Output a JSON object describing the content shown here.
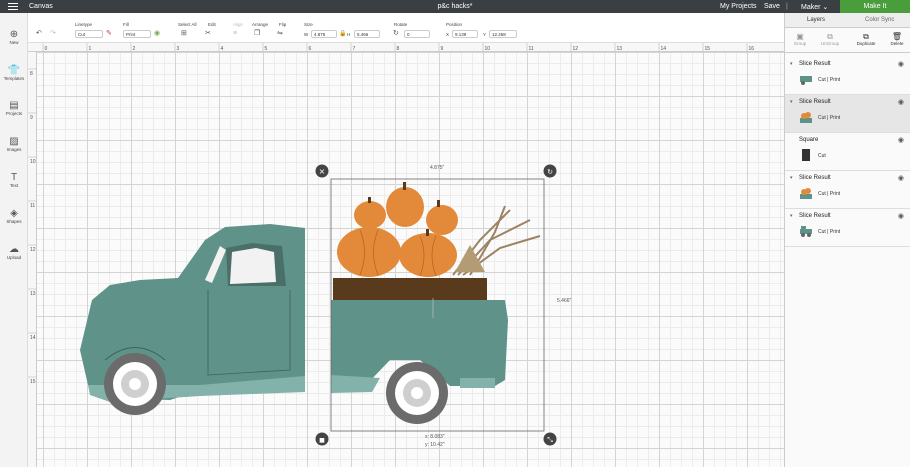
{
  "topbar": {
    "app_title": "Canvas",
    "doc_title": "p&c hacks*",
    "my_projects": "My Projects",
    "save": "Save",
    "separator": "|",
    "machine": "Maker",
    "machine_caret": "⌄",
    "make_it": "Make It"
  },
  "toolbar": {
    "linetype_label": "Linetype",
    "linetype_value": "Cut",
    "fill_label": "Fill",
    "fill_value": "Print",
    "select_all_label": "Select All",
    "edit_label": "Edit",
    "align_label": "Align",
    "arrange_label": "Arrange",
    "flip_label": "Flip",
    "size_label": "Size",
    "w_label": "W",
    "w_value": "4.875",
    "h_label": "H",
    "h_value": "5.466",
    "rotate_label": "Rotate",
    "rotate_value": "0",
    "position_label": "Position",
    "x_label": "X",
    "x_value": "9.139",
    "y_label": "Y",
    "y_value": "12.458"
  },
  "leftbar": {
    "items": [
      {
        "label": "New",
        "icon": "plus-icon"
      },
      {
        "label": "Templates",
        "icon": "shirt-icon"
      },
      {
        "label": "Projects",
        "icon": "projects-icon"
      },
      {
        "label": "Images",
        "icon": "image-icon"
      },
      {
        "label": "Text",
        "icon": "text-icon"
      },
      {
        "label": "Shapes",
        "icon": "shapes-icon"
      },
      {
        "label": "Upload",
        "icon": "upload-icon"
      }
    ]
  },
  "ruler": {
    "h_ticks": [
      "0",
      "1",
      "2",
      "3",
      "4",
      "5",
      "6",
      "7",
      "8",
      "9",
      "10",
      "11",
      "12",
      "13",
      "14",
      "15",
      "16"
    ],
    "v_ticks": [
      "8",
      "9",
      "10",
      "11",
      "12",
      "13",
      "14",
      "15"
    ]
  },
  "selection": {
    "width_label": "4.875\"",
    "height_label": "5.466\"",
    "pos_x_label": "x: 8.083\"",
    "pos_y_label": "y: 10.42\""
  },
  "layers_panel": {
    "tab_layers": "Layers",
    "tab_color_sync": "Color Sync",
    "actions": [
      "Group",
      "UnGroup",
      "Duplicate",
      "Delete"
    ],
    "layers": [
      {
        "name": "Slice Result",
        "op": "Cut | Print",
        "thumb": "truck-front-thumb",
        "selected": false
      },
      {
        "name": "Slice Result",
        "op": "Cut | Print",
        "thumb": "pumpkin-thumb",
        "selected": true
      },
      {
        "name": "Square",
        "op": "Cut",
        "thumb": "square-thumb",
        "selected": false
      },
      {
        "name": "Slice Result",
        "op": "Cut | Print",
        "thumb": "pumpkin-thumb",
        "selected": false
      },
      {
        "name": "Slice Result",
        "op": "Cut | Print",
        "thumb": "truck-thumb",
        "selected": false
      }
    ]
  },
  "colors": {
    "truck": "#5f9289",
    "truck_dark": "#4d7c74",
    "pumpkin": "#e38a3a",
    "crate": "#5a3a1c",
    "make_it": "#4a9d3b",
    "topbar": "#3a3f44"
  }
}
